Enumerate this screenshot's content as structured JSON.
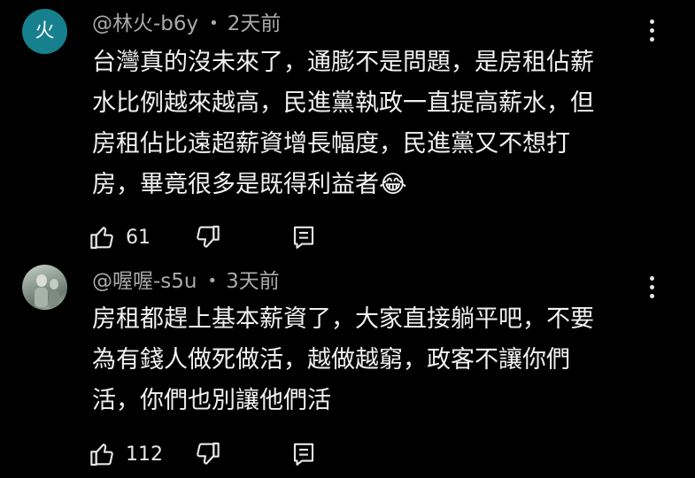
{
  "comments": [
    {
      "avatar_letter": "火",
      "avatar_color": "#17808e",
      "author": "@林火-b6y",
      "separator": "•",
      "time": "2天前",
      "text": "台灣真的沒未來了，通膨不是問題，是房租佔薪\n水比例越來越高，民進黨執政一直提高薪水，但\n房租佔比遠超薪資增長幅度，民進黨又不想打\n房，畢竟很多是既得利益者😂",
      "like_count": "61",
      "icons": [
        "thumbs-up-icon",
        "thumbs-down-icon",
        "reply-icon",
        "more-vert-icon"
      ]
    },
    {
      "avatar_letter": "",
      "author": "@喔喔-s5u",
      "separator": "•",
      "time": "3天前",
      "text": "房租都趕上基本薪資了，大家直接躺平吧，不要\n為有錢人做死做活，越做越窮，政客不讓你們\n活，你們也別讓他們活",
      "like_count": "112",
      "icons": [
        "thumbs-up-icon",
        "thumbs-down-icon",
        "reply-icon",
        "more-vert-icon"
      ]
    }
  ]
}
